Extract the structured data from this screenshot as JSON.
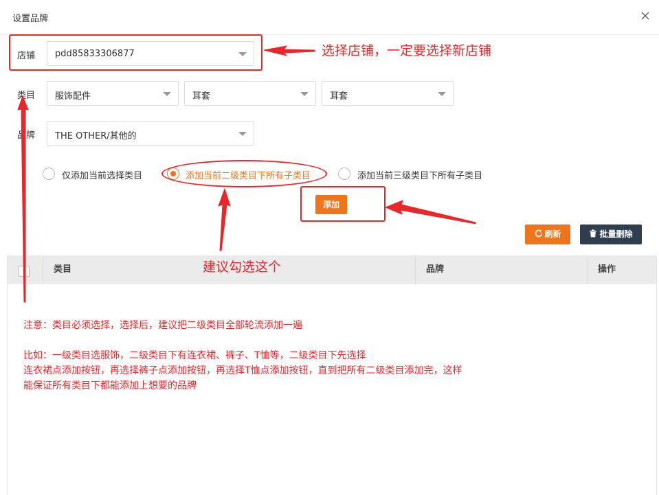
{
  "dialog": {
    "title": "设置品牌"
  },
  "form": {
    "shop_label": "店铺",
    "shop_value": "pdd85833306877",
    "category_label": "类目",
    "category_1": "服饰配件",
    "category_2": "耳套",
    "category_3": "耳套",
    "brand_label": "品牌",
    "brand_value": "THE OTHER/其他的",
    "radio_options": [
      "仅添加当前选择类目",
      "添加当前二级类目下所有子类目",
      "添加当前三级类目下所有子类目"
    ],
    "selected_radio": 1,
    "add_button": "添加"
  },
  "toolbar": {
    "refresh_label": "刷新",
    "batch_delete_label": "批量删除"
  },
  "table": {
    "columns": [
      "类目",
      "品牌",
      "操作"
    ]
  },
  "annotations": {
    "shop_note": "选择店铺，一定要选择新店铺",
    "radio_note": "建议勾选这个",
    "notes": [
      "注意：类目必须选择，选择后，建议把二级类目全部轮流添加一遍",
      "比如：一级类目选服饰，二级类目下有连衣裙、裤子、T恤等，二级类目下先选择",
      "连衣裙点添加按钮，再选择裤子点添加按钮，再选择T恤点添加按钮，直到把所有二级类目添加完，这样",
      "能保证所有类目下都能添加上想要的品牌"
    ],
    "color": "#e8272b"
  },
  "colors": {
    "accent": "#f0741b",
    "dark_button": "#2f3e4f"
  }
}
